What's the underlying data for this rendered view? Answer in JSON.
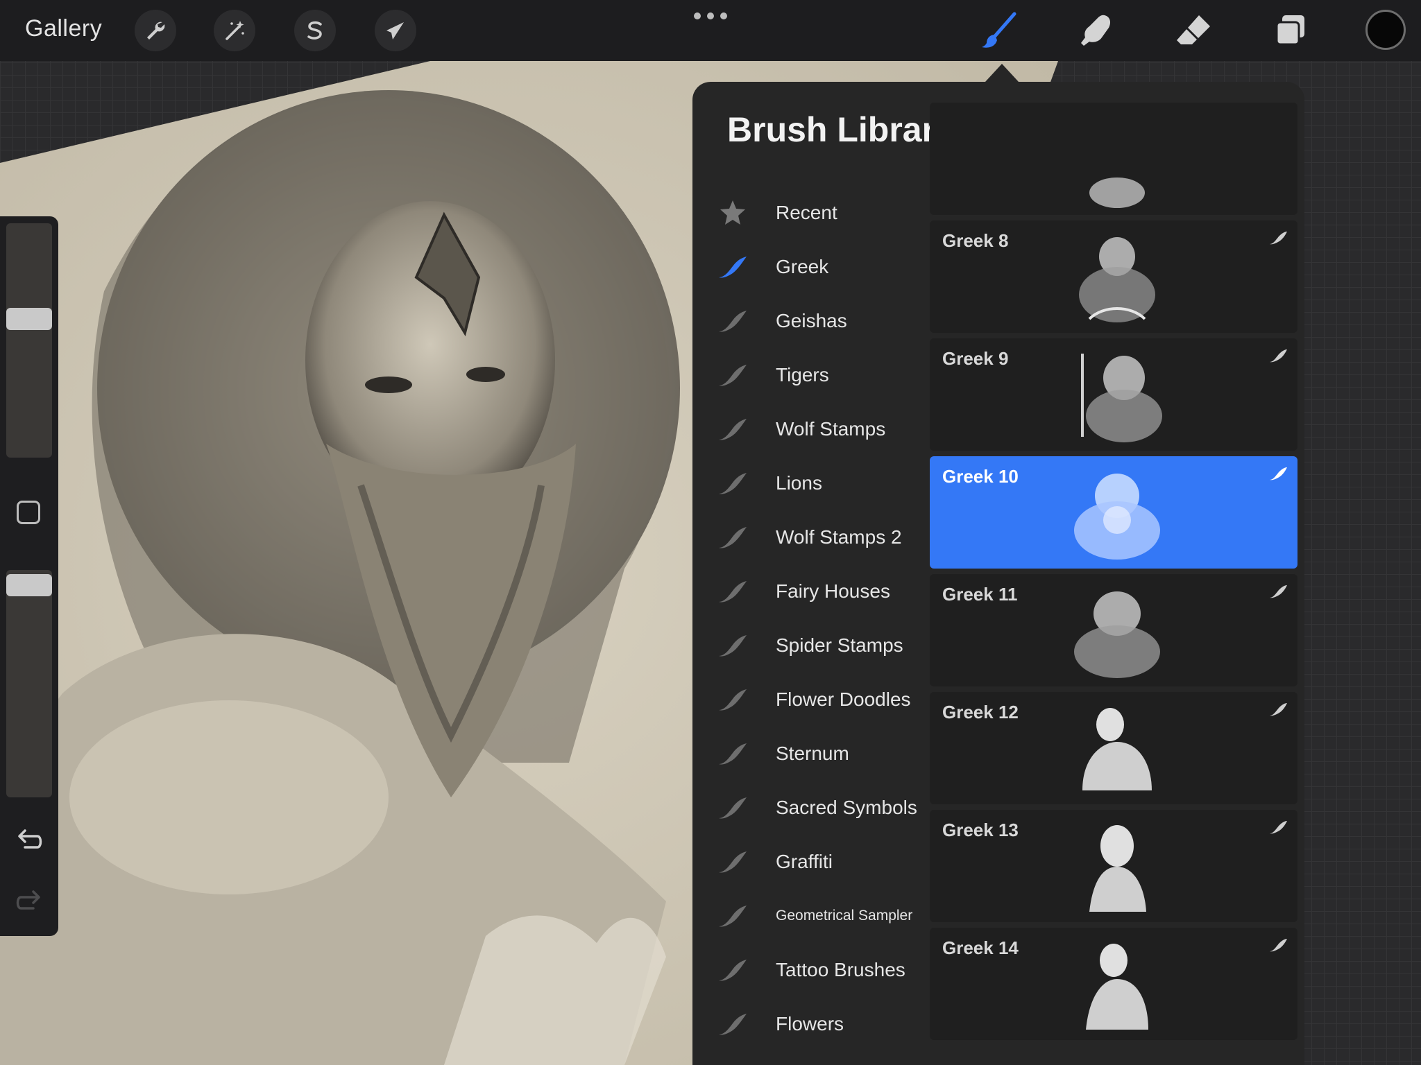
{
  "topbar": {
    "gallery_label": "Gallery",
    "left_tools": [
      {
        "name": "adjust",
        "icon": "wrench-icon"
      },
      {
        "name": "magic",
        "icon": "magic-wand-icon"
      },
      {
        "name": "selection",
        "icon": "selection-s-icon"
      },
      {
        "name": "transform",
        "icon": "arrow-cursor-icon"
      }
    ],
    "right_tools": [
      {
        "name": "brush",
        "icon": "brush-icon",
        "active": true,
        "color": "#3478f6"
      },
      {
        "name": "smudge",
        "icon": "smudge-finger-icon"
      },
      {
        "name": "eraser",
        "icon": "eraser-icon"
      },
      {
        "name": "layers",
        "icon": "layers-icon"
      }
    ],
    "current_color": "#070707"
  },
  "brush_library": {
    "title": "Brush Library",
    "sets": [
      {
        "label": "Recent",
        "icon": "star-icon"
      },
      {
        "label": "Greek",
        "icon": "brush-stroke-icon",
        "active": true
      },
      {
        "label": "Geishas",
        "icon": "brush-stroke-icon"
      },
      {
        "label": "Tigers",
        "icon": "brush-stroke-icon"
      },
      {
        "label": "Wolf Stamps",
        "icon": "brush-stroke-icon"
      },
      {
        "label": "Lions",
        "icon": "brush-stroke-icon"
      },
      {
        "label": "Wolf Stamps 2",
        "icon": "brush-stroke-icon"
      },
      {
        "label": "Fairy Houses",
        "icon": "brush-stroke-icon"
      },
      {
        "label": "Spider Stamps",
        "icon": "brush-stroke-icon"
      },
      {
        "label": "Flower Doodles",
        "icon": "brush-stroke-icon"
      },
      {
        "label": "Sternum",
        "icon": "brush-stroke-icon"
      },
      {
        "label": "Sacred Symbols",
        "icon": "brush-stroke-icon"
      },
      {
        "label": "Graffiti",
        "icon": "brush-stroke-icon"
      },
      {
        "label": "Geometrical Sampler",
        "icon": "brush-stroke-icon"
      },
      {
        "label": "Tattoo Brushes",
        "icon": "brush-stroke-icon"
      },
      {
        "label": "Flowers",
        "icon": "brush-stroke-icon"
      }
    ],
    "brushes": [
      {
        "label": "Greek 8"
      },
      {
        "label": "Greek 9"
      },
      {
        "label": "Greek 10",
        "selected": true
      },
      {
        "label": "Greek 11"
      },
      {
        "label": "Greek 12"
      },
      {
        "label": "Greek 13"
      },
      {
        "label": "Greek 14"
      }
    ]
  },
  "colors": {
    "accent": "#3478f6",
    "panel": "#262626",
    "topbar": "#1d1d1f"
  }
}
